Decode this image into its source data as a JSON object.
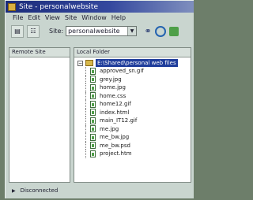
{
  "window": {
    "title": "Site - personalwebsite"
  },
  "menu": [
    "File",
    "Edit",
    "View",
    "Site",
    "Window",
    "Help"
  ],
  "toolbar": {
    "site_label": "Site:",
    "site_value": "personalwebsite"
  },
  "remote_pane": {
    "header": "Remote Site"
  },
  "local_pane": {
    "header": "Local Folder",
    "root": "E:\\Shared\\personal web files",
    "files": [
      "approved_sn.gif",
      "grey.jpg",
      "home.jpg",
      "home.css",
      "home12.gif",
      "index.html",
      "main_IT12.gif",
      "me.jpg",
      "me_bw.jpg",
      "me_bw.psd",
      "project.htm"
    ]
  },
  "status": {
    "text": "Disconnected"
  }
}
